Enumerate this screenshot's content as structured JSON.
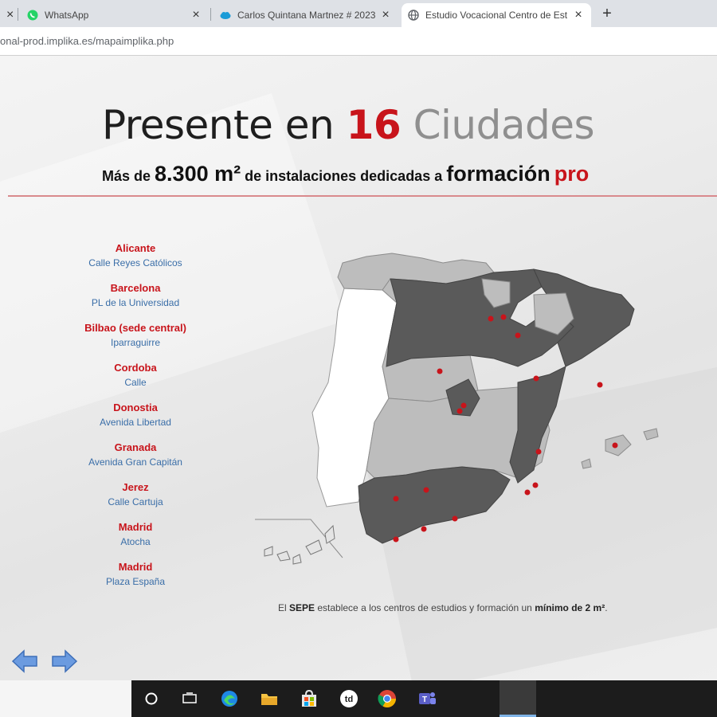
{
  "browser": {
    "tabs": [
      {
        "label": "WhatsApp",
        "icon": "whatsapp-icon"
      },
      {
        "label": "Carlos Quintana Martnez # 2023",
        "icon": "salesforce-cloud-icon"
      },
      {
        "label": "Estudio Vocacional Centro de Est",
        "icon": "globe-icon",
        "active": true
      }
    ],
    "new_tab": "+",
    "close": "×",
    "url": "onal-prod.implika.es/mapaimplika.php"
  },
  "page": {
    "headline": {
      "prefix": "Presente en ",
      "number": "16",
      "suffix": " Ciudades"
    },
    "subline": {
      "part1": "Más de ",
      "area": "8.300 m²",
      "part2": " de instalaciones dedicadas a ",
      "word1": "formación",
      "word2": "pro"
    },
    "cities": [
      {
        "name": "Alicante",
        "address": "Calle Reyes Católicos"
      },
      {
        "name": "Barcelona",
        "address": "PL de la Universidad"
      },
      {
        "name": "Bilbao (sede central)",
        "address": "Iparraguirre"
      },
      {
        "name": "Cordoba",
        "address": "Calle"
      },
      {
        "name": "Donostia",
        "address": "Avenida Libertad"
      },
      {
        "name": "Granada",
        "address": "Avenida Gran Capitán"
      },
      {
        "name": "Jerez",
        "address": "Calle Cartuja"
      },
      {
        "name": "Madrid",
        "address": "Atocha"
      },
      {
        "name": "Madrid",
        "address": "Plaza España"
      }
    ],
    "footnote": {
      "p1": "El ",
      "bold1": "SEPE",
      "p2": " establece a los centros de estudios y formación un ",
      "bold2": "mínimo de 2 m²",
      "p3": "."
    }
  },
  "colors": {
    "accent_red": "#c8141b",
    "region_dark": "#5a5a5a",
    "region_light": "#bdbdbd",
    "link_blue": "#3a6ea8",
    "arrow_blue": "#4a7fc8"
  }
}
